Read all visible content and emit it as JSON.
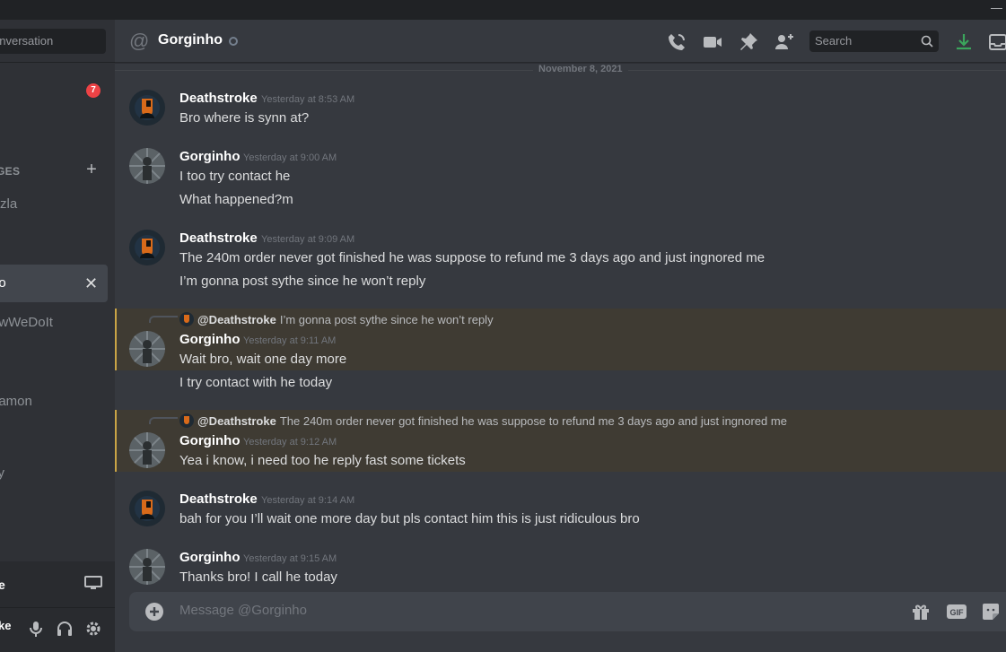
{
  "window": {
    "minimize_glyph": "—"
  },
  "sidebar": {
    "find_placeholder": "onversation",
    "badge_count": "7",
    "dm_header": "GES",
    "dm_add": "+",
    "items": [
      {
        "label": "Vzla"
      },
      {
        "label": "ho",
        "active": true
      },
      {
        "label": "owWeDoIt"
      },
      {
        "label": "namon"
      },
      {
        "label": "ky"
      }
    ]
  },
  "user_panel": {
    "voice_label": "e",
    "user_name": "ke"
  },
  "header": {
    "channel": "Gorginho",
    "search_placeholder": "Search",
    "download_color": "#3ba55c"
  },
  "chat": {
    "date_divider": "November 8, 2021",
    "groups": [
      {
        "author": "Deathstroke",
        "timestamp": "Yesterday at 8:53 AM",
        "lines": [
          "Bro where is synn at?"
        ]
      },
      {
        "author": "Gorginho",
        "timestamp": "Yesterday at 9:00 AM",
        "lines": [
          "I too try contact he",
          "What happened?m"
        ]
      },
      {
        "author": "Deathstroke",
        "timestamp": "Yesterday at 9:09 AM",
        "lines": [
          "The 240m order never got finished he was suppose to refund me 3 days ago and just ingnored me",
          "I’m gonna post sythe since he won’t reply"
        ]
      },
      {
        "author": "Gorginho",
        "timestamp": "Yesterday at 9:11 AM",
        "reply_to": "@Deathstroke",
        "reply_text": "I’m gonna post sythe since he won’t reply",
        "lines": [
          "Wait bro, wait one day more",
          "I try contact with he today"
        ]
      },
      {
        "author": "Gorginho",
        "timestamp": "Yesterday at 9:12 AM",
        "reply_to": "@Deathstroke",
        "reply_text": "The 240m order never got finished he was suppose to refund me 3 days ago and just ingnored me",
        "lines": [
          "Yea i know, i need too he reply fast some tickets"
        ]
      },
      {
        "author": "Deathstroke",
        "timestamp": "Yesterday at 9:14 AM",
        "lines": [
          "bah for you I’ll wait one more day but pls contact him this is just ridiculous bro"
        ]
      },
      {
        "author": "Gorginho",
        "timestamp": "Yesterday at 9:15 AM",
        "lines": [
          "Thanks bro! I call he today"
        ]
      }
    ]
  },
  "composer": {
    "placeholder": "Message @Gorginho",
    "gif_label": "GIF"
  }
}
